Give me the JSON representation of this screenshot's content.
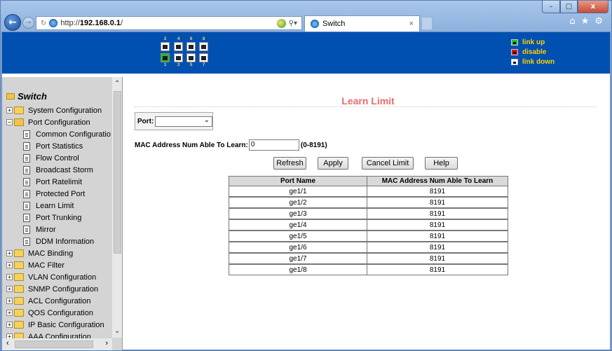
{
  "browser": {
    "url_prefix": "http://",
    "url_host": "192.168.0.1",
    "url_suffix": "/",
    "tab_title": "Switch",
    "tab_close": "×",
    "window_buttons": {
      "min": "–",
      "max": "□",
      "close": "x"
    }
  },
  "banner": {
    "port_numbers_top": [
      "2",
      "4",
      "6",
      "8"
    ],
    "port_numbers_bottom": [
      "1",
      "3",
      "5",
      "7"
    ],
    "legend": [
      {
        "label": "link up",
        "color": "#28b928"
      },
      {
        "label": "disable",
        "color": "#e01010"
      },
      {
        "label": "link down",
        "color": "#ffffff"
      }
    ]
  },
  "sidebar": {
    "root": "Switch",
    "items": [
      {
        "label": "System Configuration",
        "type": "folder",
        "level": 1
      },
      {
        "label": "Port Configuration",
        "type": "folder-open",
        "level": 1
      },
      {
        "label": "Common Configuratio",
        "type": "doc",
        "level": 2
      },
      {
        "label": "Port Statistics",
        "type": "doc",
        "level": 2
      },
      {
        "label": "Flow Control",
        "type": "doc",
        "level": 2
      },
      {
        "label": "Broadcast Storm",
        "type": "doc",
        "level": 2
      },
      {
        "label": "Port Ratelimit",
        "type": "doc",
        "level": 2
      },
      {
        "label": "Protected Port",
        "type": "doc",
        "level": 2
      },
      {
        "label": "Learn Limit",
        "type": "doc",
        "level": 2
      },
      {
        "label": "Port Trunking",
        "type": "doc",
        "level": 2
      },
      {
        "label": "Mirror",
        "type": "doc",
        "level": 2
      },
      {
        "label": "DDM Information",
        "type": "doc",
        "level": 2
      },
      {
        "label": "MAC Binding",
        "type": "folder",
        "level": 1
      },
      {
        "label": "MAC Filter",
        "type": "folder",
        "level": 1
      },
      {
        "label": "VLAN Configuration",
        "type": "folder",
        "level": 1
      },
      {
        "label": "SNMP Configuration",
        "type": "folder",
        "level": 1
      },
      {
        "label": "ACL Configuration",
        "type": "folder",
        "level": 1
      },
      {
        "label": "QOS Configuration",
        "type": "folder",
        "level": 1
      },
      {
        "label": "IP Basic Configuration",
        "type": "folder",
        "level": 1
      },
      {
        "label": "AAA Configuration",
        "type": "folder",
        "level": 1
      }
    ]
  },
  "main": {
    "title": "Learn Limit",
    "port_label": "Port:",
    "port_value": "",
    "mac_label": "MAC Address Num Able To Learn:",
    "mac_value": "0",
    "mac_range": "(0-8191)",
    "buttons": {
      "refresh": "Refresh",
      "apply": "Apply",
      "cancel": "Cancel Limit",
      "help": "Help"
    },
    "table": {
      "headers": [
        "Port Name",
        "MAC Address Num Able To Learn"
      ],
      "rows": [
        [
          "ge1/1",
          "8191"
        ],
        [
          "ge1/2",
          "8191"
        ],
        [
          "ge1/3",
          "8191"
        ],
        [
          "ge1/4",
          "8191"
        ],
        [
          "ge1/5",
          "8191"
        ],
        [
          "ge1/6",
          "8191"
        ],
        [
          "ge1/7",
          "8191"
        ],
        [
          "ge1/8",
          "8191"
        ]
      ]
    }
  }
}
